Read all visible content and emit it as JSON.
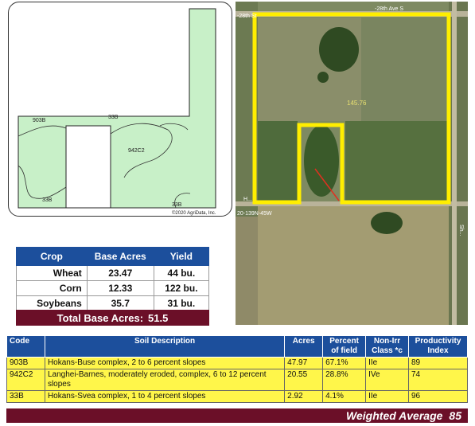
{
  "soil_map": {
    "labels": {
      "l1": "903B",
      "l2": "33B",
      "l3": "942C2",
      "l4": "33B",
      "l5": "33B",
      "copyright": "©2020 AgriData, Inc."
    },
    "colors": {
      "field_fill": "#c8f0c8",
      "field_stroke": "#222222"
    }
  },
  "aerial": {
    "acres_label": "145.76",
    "road_labels": {
      "top_left": "-28th St",
      "top_right": "-28th Ave S",
      "bottom_left": "20-139N-45W",
      "left_small": "H...",
      "right_vertical": "Sh..."
    },
    "colors": {
      "boundary": "#ffee00"
    }
  },
  "crop_table": {
    "headers": [
      "Crop",
      "Base Acres",
      "Yield"
    ],
    "rows": [
      {
        "crop": "Wheat",
        "acres": "23.47",
        "yield": "44 bu."
      },
      {
        "crop": "Corn",
        "acres": "12.33",
        "yield": "122 bu."
      },
      {
        "crop": "Soybeans",
        "acres": "35.7",
        "yield": "31 bu."
      }
    ],
    "total_label": "Total Base Acres:",
    "total_value": "51.5"
  },
  "soil_table": {
    "headers": {
      "code": "Code",
      "desc": "Soil Description",
      "acres": "Acres",
      "percent": "Percent of field",
      "class": "Non-Irr Class *c",
      "index": "Productivity Index"
    },
    "rows": [
      {
        "code": "903B",
        "desc": "Hokans-Buse complex, 2 to 6 percent slopes",
        "acres": "47.97",
        "percent": "67.1%",
        "class": "IIe",
        "index": "89"
      },
      {
        "code": "942C2",
        "desc": "Langhei-Barnes, moderately eroded, complex, 6 to 12 percent slopes",
        "acres": "20.55",
        "percent": "28.8%",
        "class": "IVe",
        "index": "74"
      },
      {
        "code": "33B",
        "desc": "Hokans-Svea complex, 1 to 4 percent slopes",
        "acres": "2.92",
        "percent": "4.1%",
        "class": "IIe",
        "index": "96"
      }
    ],
    "weighted_label": "Weighted Average",
    "weighted_value": "85"
  }
}
